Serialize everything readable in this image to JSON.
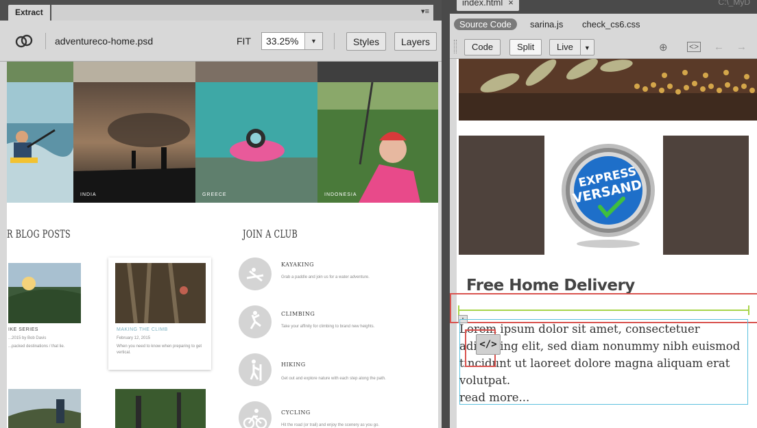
{
  "extract": {
    "tab_label": "Extract",
    "menu_glyph": "▾≡",
    "file_name": "adventureco-home.psd",
    "fit_label": "FIT",
    "zoom_value": "33.25%",
    "styles_btn": "Styles",
    "layers_btn": "Layers",
    "photo_captions": [
      "INDIA",
      "GREECE",
      "INDONESIA"
    ],
    "blog_heading": "R BLOG POSTS",
    "club_heading": "JOIN A CLUB",
    "blog_cards": [
      {
        "title": "IKE SERIES",
        "date": "...2015 by Bob Davis",
        "desc": "...packed destinations / that lie."
      },
      {
        "title": "MAKING THE CLIMB",
        "date": "February 12, 2015",
        "desc": "When you need to know when preparing to get vertical."
      }
    ],
    "clubs": [
      {
        "title": "KAYAKING",
        "desc": "Grab a paddle and join us for a water adventure."
      },
      {
        "title": "CLIMBING",
        "desc": "Take your affinity for climbing to brand new heights."
      },
      {
        "title": "HIKING",
        "desc": "Get out and explore nature with each step along the path."
      },
      {
        "title": "CYCLING",
        "desc": "Hit the road (or trail) and enjoy the scenery as you go."
      }
    ]
  },
  "dw": {
    "tab_label": "index.html",
    "tab_close": "×",
    "path_text": "C:\\_MyD",
    "source_code": "Source Code",
    "related_files": [
      "sarina.js",
      "check_cs6.css"
    ],
    "view_buttons": [
      "Code",
      "Split"
    ],
    "live_label": "Live",
    "badge_line1": "EXPRESS",
    "badge_line2": "VERSAND",
    "delivery_title": "Free Home Delivery",
    "lorem": "Lorem ipsum dolor sit amet, consectetuer adipiscing elit, sed diam nonummy nibh euismod tincidunt ut laoreet dolore magna aliquam erat volutpat.",
    "read_more": "read more...",
    "code_chip": "</>"
  },
  "colors": {
    "brown": "#4e423c",
    "green_line": "#a8d44a",
    "selection_red": "#d9534f",
    "selection_blue": "#5bc0de"
  }
}
